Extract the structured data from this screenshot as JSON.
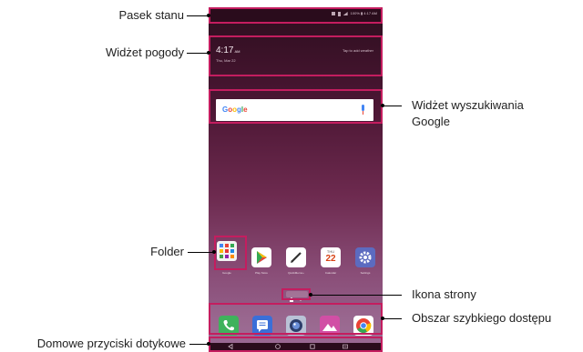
{
  "callouts": {
    "status_bar": "Pasek stanu",
    "weather_widget": "Widżet pogody",
    "google_search_widget_line1": "Widżet wyszukiwania",
    "google_search_widget_line2": "Google",
    "folder": "Folder",
    "page_icon": "Ikona strony",
    "quick_access": "Obszar szybkiego dostępu",
    "home_touch_buttons": "Domowe przyciski dotykowe"
  },
  "screen": {
    "status_text": "100%  ▮ 4:17 AM",
    "weather": {
      "time": "4:17",
      "time_suffix": "AM",
      "date": "Thu, Mar 22",
      "tap_hint": "Tap to add weather"
    },
    "google": {
      "logo": "Google"
    },
    "apps": [
      {
        "label": "Google",
        "icon": "folder-icon"
      },
      {
        "label": "Play Store",
        "icon": "play-store-icon"
      },
      {
        "label": "QuickMemo+",
        "icon": "memo-pen-icon"
      },
      {
        "label": "Calendar",
        "icon": "calendar-icon",
        "day": "THU",
        "date": "22"
      },
      {
        "label": "Settings",
        "icon": "settings-gear-icon"
      }
    ],
    "dock": [
      {
        "icon": "phone-icon"
      },
      {
        "icon": "messages-icon"
      },
      {
        "icon": "camera-icon"
      },
      {
        "icon": "gallery-icon"
      },
      {
        "icon": "chrome-icon"
      }
    ],
    "nav": [
      {
        "icon": "back-icon"
      },
      {
        "icon": "home-icon"
      },
      {
        "icon": "recents-icon"
      },
      {
        "icon": "switch-sim-icon"
      }
    ]
  },
  "colors": {
    "highlight": "#c41d5f",
    "google_blue": "#4285f4",
    "google_red": "#ea4335",
    "google_yellow": "#fbbc05",
    "google_green": "#34a853"
  }
}
